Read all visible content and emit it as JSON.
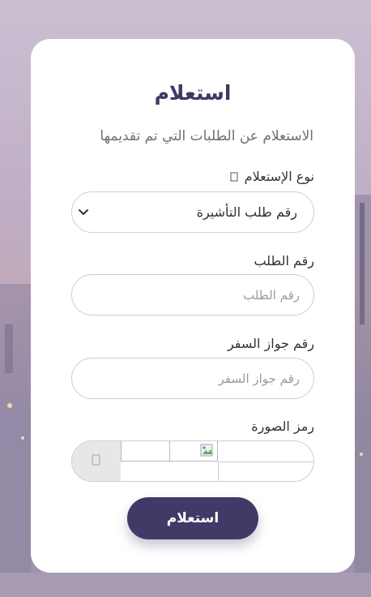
{
  "form": {
    "title": "استعلام",
    "subtitle": "الاستعلام عن الطلبات التي تم تقديمها",
    "inquiry_type": {
      "label": "نوع الإستعلام",
      "selected_value": "رقم طلب التأشيرة"
    },
    "request_number": {
      "label": "رقم الطلب",
      "placeholder": "رقم الطلب"
    },
    "passport_number": {
      "label": "رقم جواز السفر",
      "placeholder": "رقم جواز السفر"
    },
    "captcha": {
      "label": "رمز الصورة"
    },
    "submit_label": "استعلام"
  },
  "icons": {
    "info": "info-icon",
    "chevron": "chevron-down-icon",
    "refresh": "refresh-icon",
    "broken_image": "broken-image-icon"
  },
  "colors": {
    "accent": "#3f3b66",
    "title": "#3b3a63"
  }
}
